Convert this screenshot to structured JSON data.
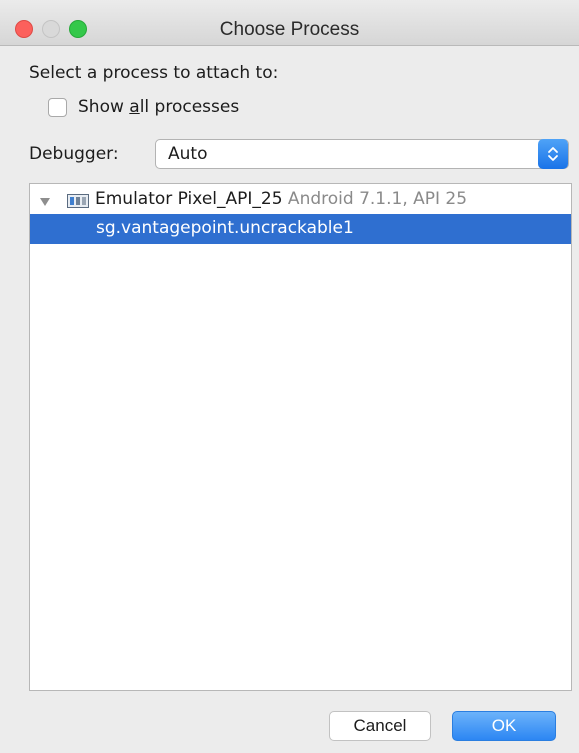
{
  "window": {
    "title": "Choose Process"
  },
  "prompt": "Select a process to attach to:",
  "show_all": {
    "prefix": "Show ",
    "mnemonic": "a",
    "suffix": "ll processes",
    "checked": false
  },
  "debugger": {
    "label": "Debugger:",
    "selected": "Auto"
  },
  "tree": {
    "device": {
      "name": "Emulator Pixel_API_25",
      "info": " Android 7.1.1, API 25",
      "icon": "device-icon",
      "expanded": true
    },
    "processes": [
      {
        "name": "sg.vantagepoint.uncrackable1",
        "selected": true
      }
    ]
  },
  "buttons": {
    "cancel": "Cancel",
    "ok": "OK"
  },
  "colors": {
    "selection": "#2f6fd0",
    "default_button": "#2c86f3"
  }
}
